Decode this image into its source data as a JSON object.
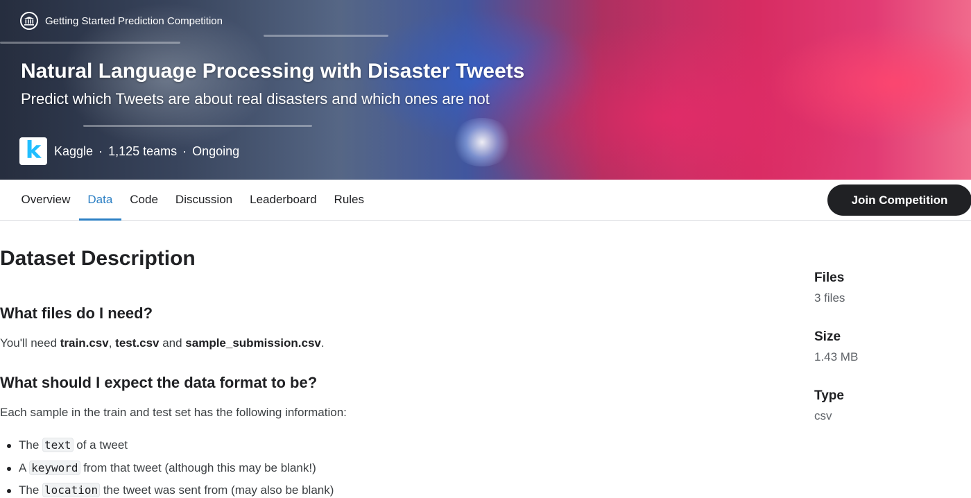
{
  "hero": {
    "competition_type": "Getting Started Prediction Competition",
    "title": "Natural Language Processing with Disaster Tweets",
    "subtitle": "Predict which Tweets are about real disasters and which ones are not",
    "host": "Kaggle",
    "teams": "1,125 teams",
    "status": "Ongoing",
    "separator": "·",
    "logo_letter": "k"
  },
  "tabs": [
    {
      "label": "Overview"
    },
    {
      "label": "Data"
    },
    {
      "label": "Code"
    },
    {
      "label": "Discussion"
    },
    {
      "label": "Leaderboard"
    },
    {
      "label": "Rules"
    }
  ],
  "active_tab": "Data",
  "join_button": "Join Competition",
  "content": {
    "title": "Dataset Description",
    "section1": {
      "heading": "What files do I need?",
      "text_prefix": "You'll need ",
      "file1": "train.csv",
      "comma": ", ",
      "file2": "test.csv",
      "and": " and ",
      "file3": "sample_submission.csv",
      "period": "."
    },
    "section2": {
      "heading": "What should I expect the data format to be?",
      "text": "Each sample in the train and test set has the following information:",
      "bullets": [
        {
          "before": "The ",
          "code": "text",
          "after": " of a tweet"
        },
        {
          "before": "A ",
          "code": "keyword",
          "after": " from that tweet (although this may be blank!)"
        },
        {
          "before": "The ",
          "code": "location",
          "after": " the tweet was sent from (may also be blank)"
        }
      ]
    }
  },
  "sidebar": {
    "files_label": "Files",
    "files_value": "3 files",
    "size_label": "Size",
    "size_value": "1.43 MB",
    "type_label": "Type",
    "type_value": "csv"
  },
  "colors": {
    "accent": "#2b7fc4",
    "button_bg": "#202124",
    "kaggle_blue": "#20beff"
  }
}
